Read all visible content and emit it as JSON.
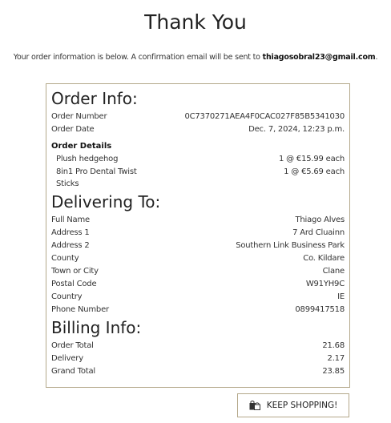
{
  "page_title": "Thank You",
  "intro_text": "Your order information is below. A confirmation email will be sent to",
  "email": "thiagosobral23@gmail.com",
  "intro_end": ".",
  "order_info": {
    "title": "Order Info:",
    "order_number_label": "Order Number",
    "order_number": "0C7370271AEA4F0CAC027F85B5341030",
    "order_date_label": "Order Date",
    "order_date": "Dec. 7, 2024, 12:23 p.m.",
    "details_title": "Order Details",
    "items": [
      {
        "name": "Plush hedgehog",
        "qty_price": "1 @ €15.99 each"
      },
      {
        "name": "8in1 Pro Dental Twist Sticks",
        "qty_price": "1 @ €5.69 each"
      }
    ]
  },
  "delivering": {
    "title": "Delivering To:",
    "rows": [
      {
        "label": "Full Name",
        "value": "Thiago Alves"
      },
      {
        "label": "Address 1",
        "value": "7 Ard Cluainn"
      },
      {
        "label": "Address 2",
        "value": "Southern Link Business Park"
      },
      {
        "label": "County",
        "value": "Co. Kildare"
      },
      {
        "label": "Town or City",
        "value": "Clane"
      },
      {
        "label": "Postal Code",
        "value": "W91YH9C"
      },
      {
        "label": "Country",
        "value": "IE"
      },
      {
        "label": "Phone Number",
        "value": "0899417518"
      }
    ]
  },
  "billing": {
    "title": "Billing Info:",
    "rows": [
      {
        "label": "Order Total",
        "value": "21.68"
      },
      {
        "label": "Delivery",
        "value": "2.17"
      },
      {
        "label": "Grand Total",
        "value": "23.85"
      }
    ]
  },
  "keep_shopping_label": "KEEP SHOPPING!",
  "keep_shopping_icon": "shopping-bags-icon",
  "colors": {
    "border": "#b4a88a",
    "text": "#222222"
  }
}
